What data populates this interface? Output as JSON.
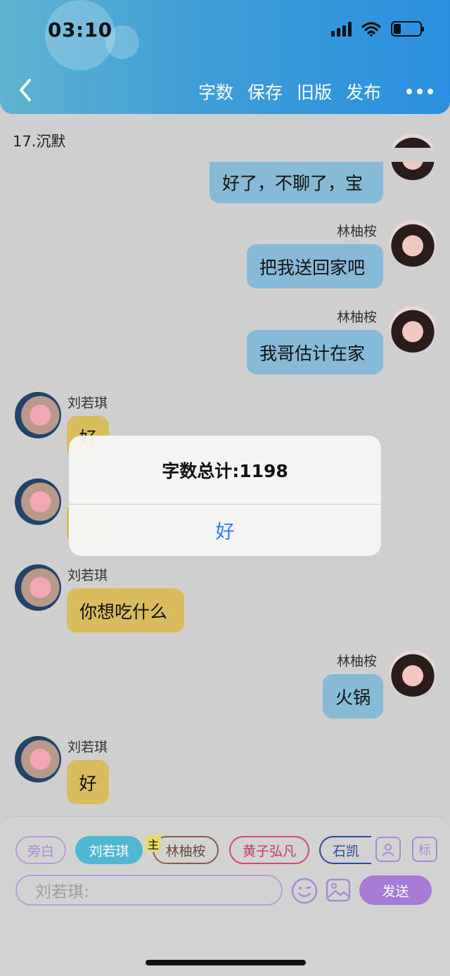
{
  "status_bar": {
    "time": "03:10"
  },
  "nav": {
    "actions": [
      "字数",
      "保存",
      "旧版",
      "发布"
    ]
  },
  "chapter_title": "17.沉默",
  "messages": [
    {
      "text": "好了，不聊了，宝"
    },
    {
      "name": "林柚桉",
      "text": "把我送回家吧"
    },
    {
      "name": "林柚桉",
      "text": "我哥估计在家"
    },
    {
      "name": "刘若琪",
      "text": "好"
    },
    {
      "name": "刘若琪",
      "text": "你想吃什么"
    },
    {
      "name": "林柚桉",
      "text": "火锅"
    },
    {
      "name": "刘若琪",
      "text": "好"
    }
  ],
  "dialog": {
    "title": "字数总计:1198",
    "button": "好"
  },
  "composer": {
    "roles": [
      "旁白",
      "刘若琪",
      "林柚桉",
      "黄子弘凡",
      "石凯"
    ],
    "main_tag": "主",
    "input_placeholder": "刘若琪:",
    "send_label": "发送",
    "tag_icon_label": "标"
  },
  "colors": {
    "header_accent": "#2a8fe0",
    "self_bubble": "#86bad7",
    "other_bubble": "#d8bc5e",
    "send": "#a77bd4"
  }
}
